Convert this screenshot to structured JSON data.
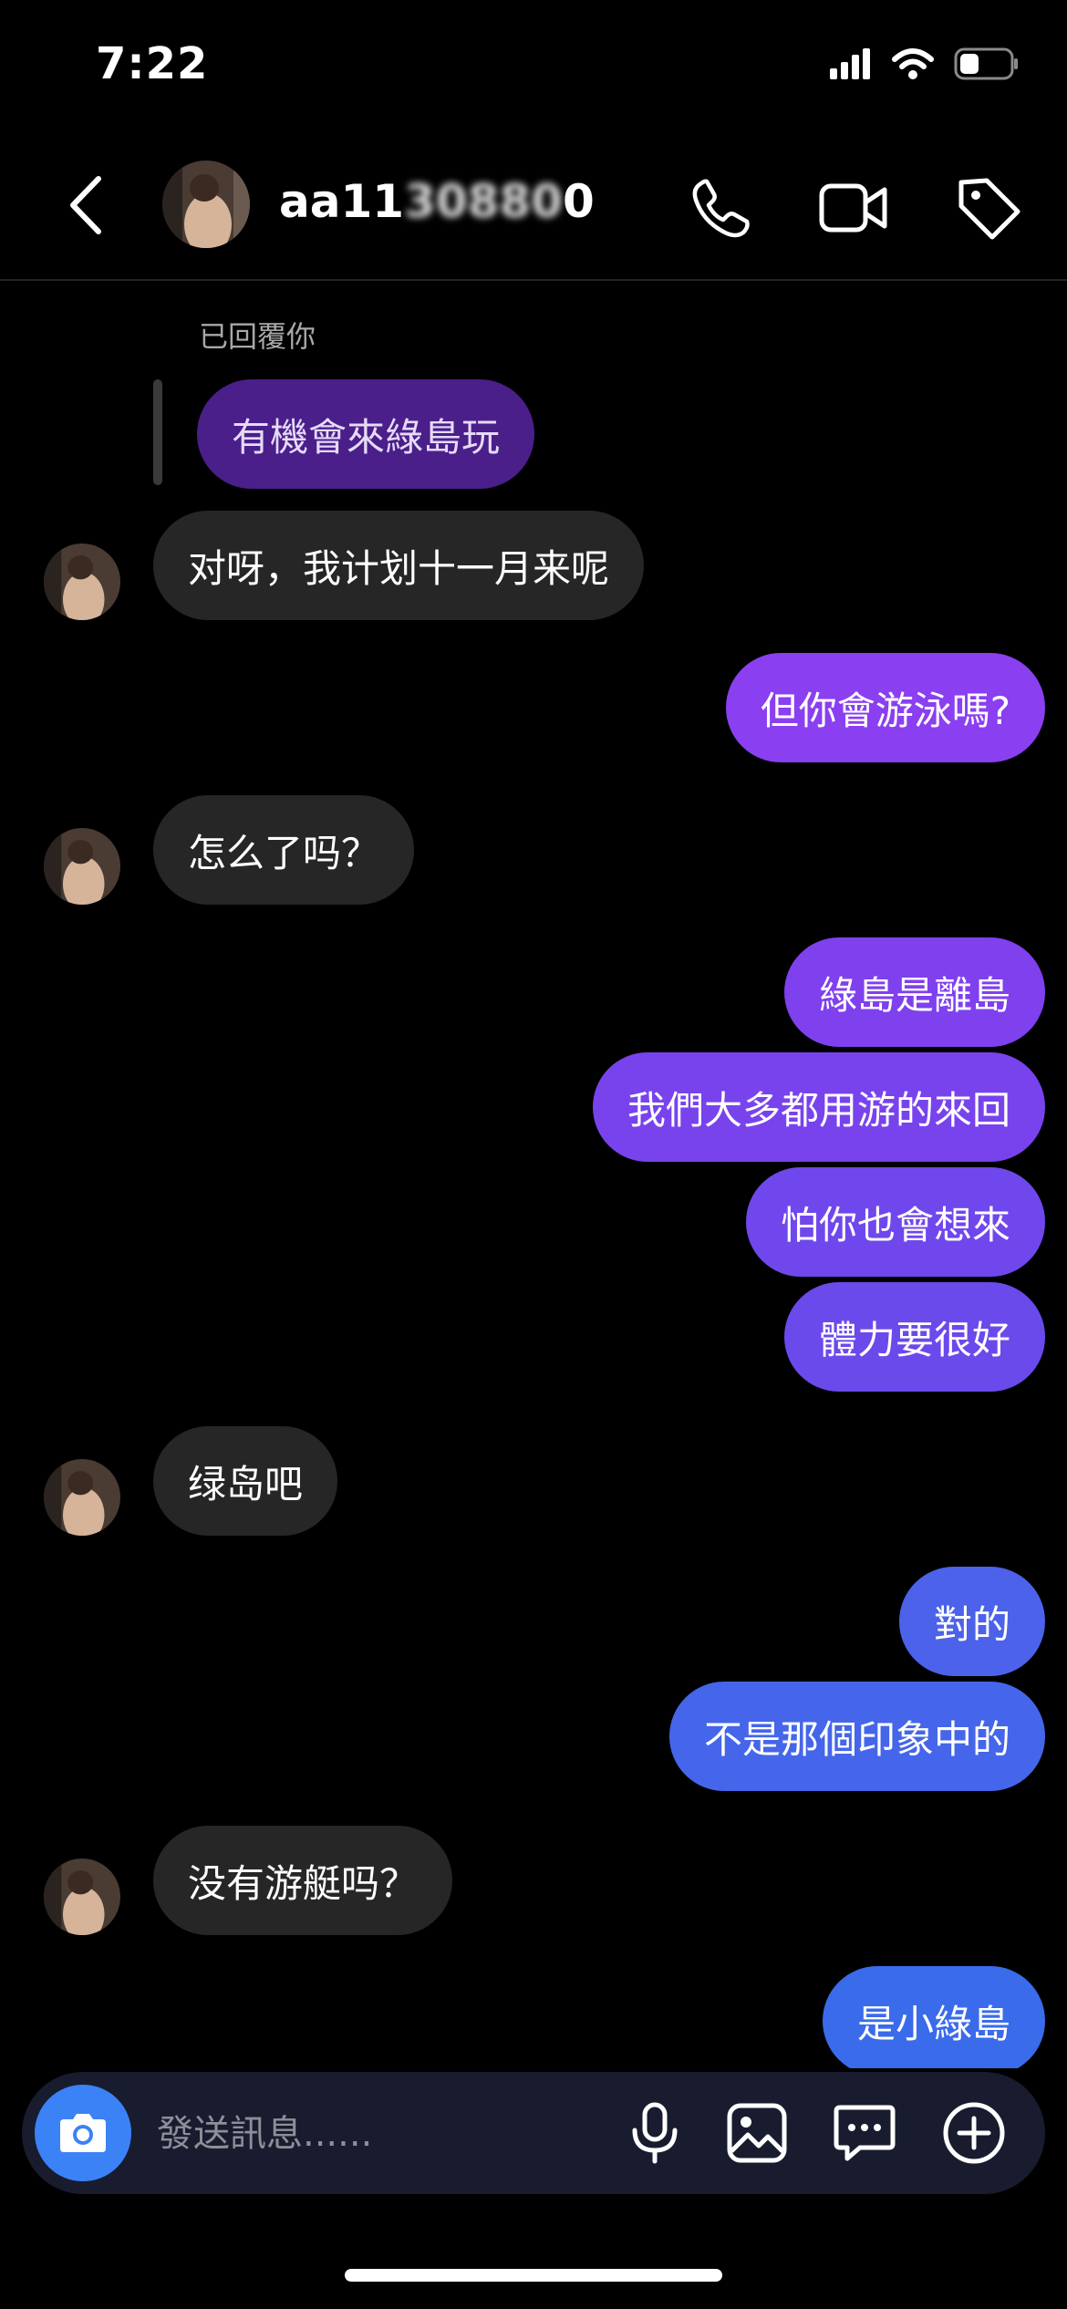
{
  "status_bar": {
    "time": "7:22",
    "icons": [
      "signal-icon",
      "wifi-icon",
      "battery-icon"
    ]
  },
  "header": {
    "contact_name_visible": "aa11",
    "contact_name_blurred": "30880",
    "contact_name_suffix": "0",
    "icons": [
      "chevron-left-icon",
      "avatar",
      "phone-icon",
      "video-camera-icon",
      "tag-icon"
    ]
  },
  "messages": {
    "reply_note": "已回覆你",
    "quoted_message": "有機會來綠島玩",
    "items": [
      {
        "sender": "them",
        "text": "对呀，我计划十一月来呢"
      },
      {
        "sender": "me",
        "text": "但你會游泳嗎?"
      },
      {
        "sender": "them",
        "text": "怎么了吗？"
      },
      {
        "sender": "me",
        "text": "綠島是離島"
      },
      {
        "sender": "me",
        "text": "我們大多都用游的來回"
      },
      {
        "sender": "me",
        "text": "怕你也會想來"
      },
      {
        "sender": "me",
        "text": "體力要很好"
      },
      {
        "sender": "them",
        "text": "绿岛吧"
      },
      {
        "sender": "me",
        "text": "對的"
      },
      {
        "sender": "me",
        "text": "不是那個印象中的"
      },
      {
        "sender": "them",
        "text": "没有游艇吗？"
      },
      {
        "sender": "me",
        "text": "是小綠島"
      }
    ]
  },
  "composer": {
    "placeholder": "發送訊息......",
    "icons": [
      "camera-icon",
      "microphone-icon",
      "image-icon",
      "chat-bubble-icon",
      "plus-circle-icon"
    ]
  },
  "colors": {
    "background": "#000000",
    "incoming_bubble": "#262626",
    "quoted_bubble": "#4a1f8a",
    "outgoing_gradient_top": "#8a3ff0",
    "outgoing_gradient_bottom": "#3a6bea",
    "camera_button": "#3b82f6",
    "composer_bg": "#181c2e"
  }
}
